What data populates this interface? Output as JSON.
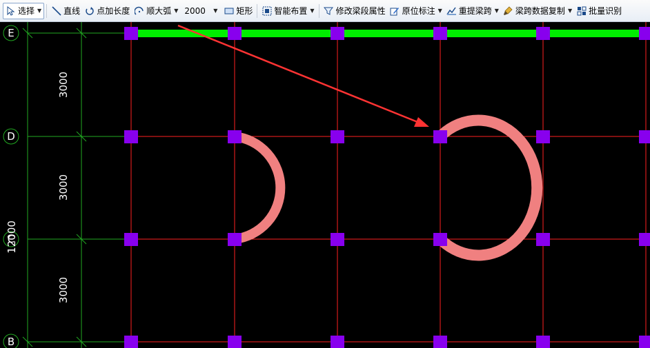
{
  "toolbar": {
    "select_label": "选择",
    "line_label": "直线",
    "point_length_label": "点加长度",
    "arc_label": "顺大弧",
    "arc_value": "2000",
    "rect_label": "矩形",
    "smart_layout_label": "智能布置",
    "modify_segment_label": "修改梁段属性",
    "origin_label_label": "原位标注",
    "re_extract_label": "重提梁跨",
    "copy_span_label": "梁跨数据复制",
    "batch_label": "批量识别"
  },
  "drawing": {
    "axis_labels": [
      "E",
      "D",
      "C",
      "B"
    ],
    "dimensions": [
      "3000",
      "3000",
      "3000"
    ],
    "total_dimension": "12000",
    "colors": {
      "background": "#000000",
      "grid_red": "#ff2020",
      "dim_green": "#22aa22",
      "column_purple": "#8800ee",
      "beam_green": "#00ee00",
      "arc_pink": "#f08080",
      "arrow_red": "#ff3333"
    }
  }
}
